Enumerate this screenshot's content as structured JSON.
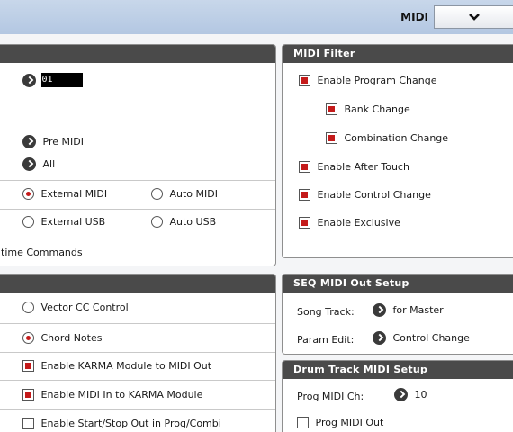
{
  "topbar": {
    "mode": "MIDI"
  },
  "midi_panel": {
    "channel_value": "01",
    "pre_midi": "Pre MIDI",
    "all": "All",
    "clock_source": {
      "external_midi": "External MIDI",
      "auto_midi": "Auto MIDI",
      "external_usb": "External USB",
      "auto_usb": "Auto USB"
    },
    "realtime_commands": "time Commands"
  },
  "midi_filter": {
    "title": "MIDI Filter",
    "enable_program_change": "Enable Program Change",
    "bank_change": "Bank Change",
    "combination_change": "Combination Change",
    "enable_after_touch": "Enable After Touch",
    "enable_control_change": "Enable Control Change",
    "enable_exclusive": "Enable Exclusive"
  },
  "lower_panel": {
    "vector_cc_control": "Vector CC Control",
    "chord_notes": "Chord Notes",
    "enable_karma_to_midi_out": "Enable KARMA Module to MIDI Out",
    "enable_midi_in_to_karma": "Enable MIDI In to KARMA Module",
    "enable_start_stop_out": "Enable Start/Stop Out in Prog/Combi"
  },
  "seq_midi_out": {
    "title": "SEQ MIDI Out Setup",
    "song_track_label": "Song Track:",
    "song_track_value": "for Master",
    "param_edit_label": "Param Edit:",
    "param_edit_value": "Control Change"
  },
  "drum_track": {
    "title": "Drum Track MIDI Setup",
    "prog_midi_ch_label": "Prog MIDI Ch:",
    "prog_midi_ch_value": "10",
    "prog_midi_out": "Prog MIDI Out"
  },
  "colors": {
    "accent_red": "#c41a1a",
    "header_dark": "#4a4a4a",
    "topbar_blue": "#b3c7e2"
  },
  "icons": {
    "dropdown": "chevron-down-icon",
    "arrow_button": "arrow-right-circle-icon"
  }
}
